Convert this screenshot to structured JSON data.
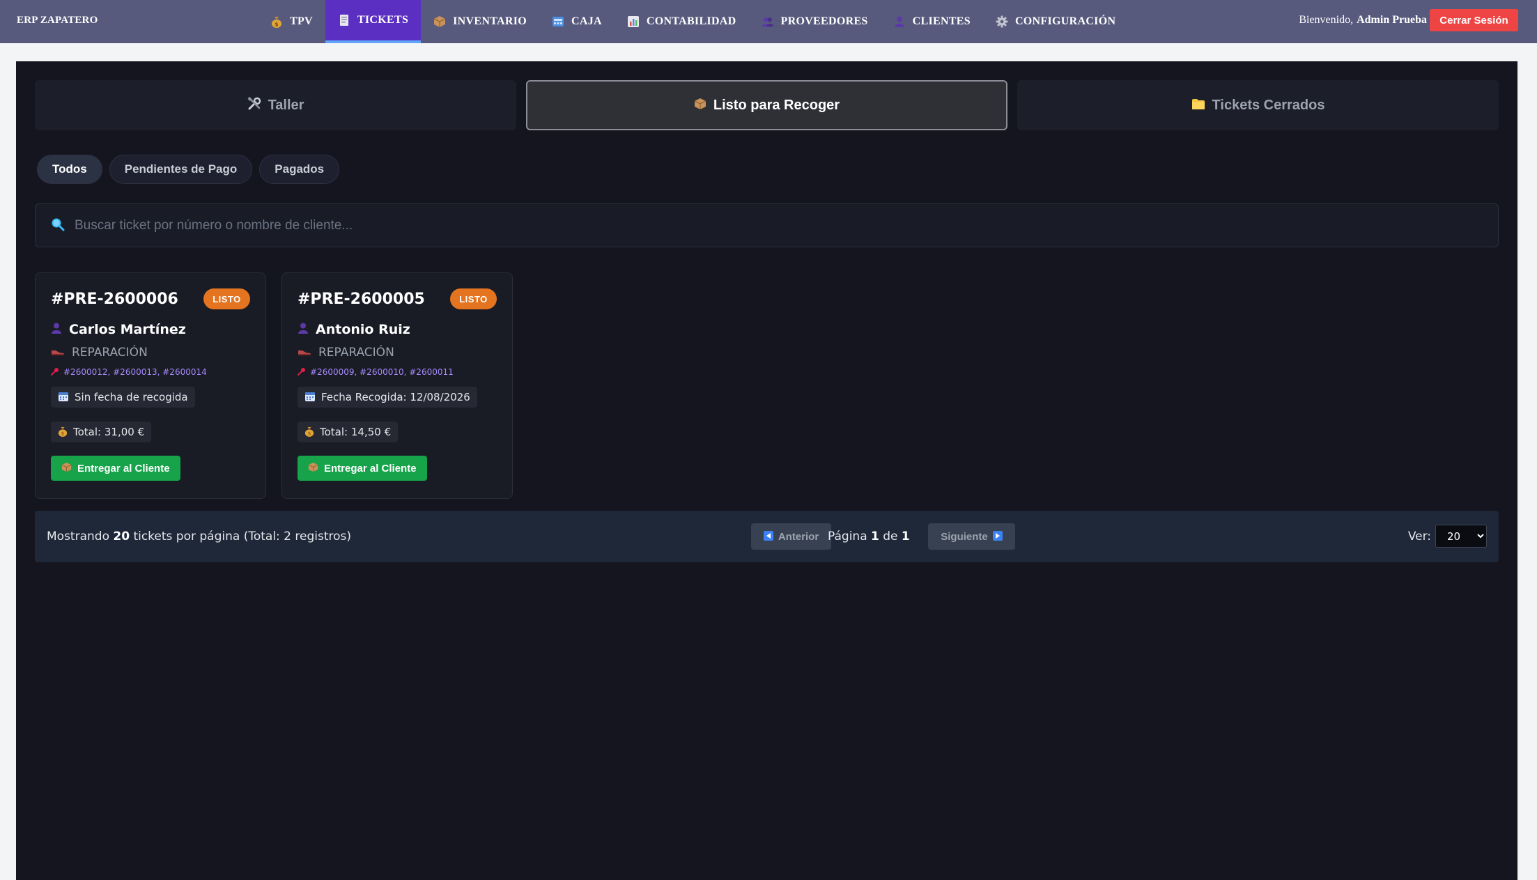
{
  "app": {
    "brand": "ERP ZAPATERO",
    "nav": [
      {
        "label": "TPV",
        "icon": "money-bag-icon",
        "active": false
      },
      {
        "label": "TICKETS",
        "icon": "receipt-icon",
        "active": true
      },
      {
        "label": "INVENTARIO",
        "icon": "package-icon",
        "active": false
      },
      {
        "label": "CAJA",
        "icon": "cash-register-icon",
        "active": false
      },
      {
        "label": "CONTABILIDAD",
        "icon": "bar-chart-icon",
        "active": false
      },
      {
        "label": "PROVEEDORES",
        "icon": "people-icon",
        "active": false
      },
      {
        "label": "CLIENTES",
        "icon": "user-icon",
        "active": false
      },
      {
        "label": "CONFIGURACIÓN",
        "icon": "gear-icon",
        "active": false
      }
    ],
    "welcome_prefix": "Bienvenido,",
    "user_name": "Admin Prueba",
    "logout_label": "Cerrar Sesión"
  },
  "tabs": [
    {
      "label": "Taller",
      "icon": "tools-icon",
      "active": false
    },
    {
      "label": "Listo para Recoger",
      "icon": "package-icon",
      "active": true
    },
    {
      "label": "Tickets Cerrados",
      "icon": "folder-icon",
      "active": false
    }
  ],
  "filters": [
    {
      "label": "Todos",
      "active": true
    },
    {
      "label": "Pendientes de Pago",
      "active": false
    },
    {
      "label": "Pagados",
      "active": false
    }
  ],
  "search": {
    "placeholder": "Buscar ticket por número o nombre de cliente...",
    "value": ""
  },
  "tickets": [
    {
      "number": "#PRE-2600006",
      "status": "LISTO",
      "client": "Carlos Martínez",
      "type": "REPARACIÓN",
      "refs": "#2600012, #2600013, #2600014",
      "pickup": "Sin fecha de recogida",
      "total": "Total: 31,00 €",
      "action": "Entregar al Cliente"
    },
    {
      "number": "#PRE-2600005",
      "status": "LISTO",
      "client": "Antonio Ruiz",
      "type": "REPARACIÓN",
      "refs": "#2600009, #2600010, #2600011",
      "pickup": "Fecha Recogida: 12/08/2026",
      "total": "Total: 14,50 €",
      "action": "Entregar al Cliente"
    }
  ],
  "pagination": {
    "showing_prefix": "Mostrando ",
    "per_page": "20",
    "showing_suffix": " tickets por página (Total: 2 registros)",
    "prev_label": "Anterior",
    "page_prefix": "Página ",
    "current_page": "1",
    "page_mid": " de ",
    "total_pages": "1",
    "next_label": "Siguiente",
    "ver_label": "Ver:",
    "ver_value": "20"
  },
  "colors": {
    "topbar": "#585a7d",
    "nav_active": "#5b2fc2",
    "logout": "#ef4444",
    "panel": "#14151f",
    "badge": "#e4741f",
    "deliver_button": "#16a34a",
    "refs": "#a78bfa"
  }
}
